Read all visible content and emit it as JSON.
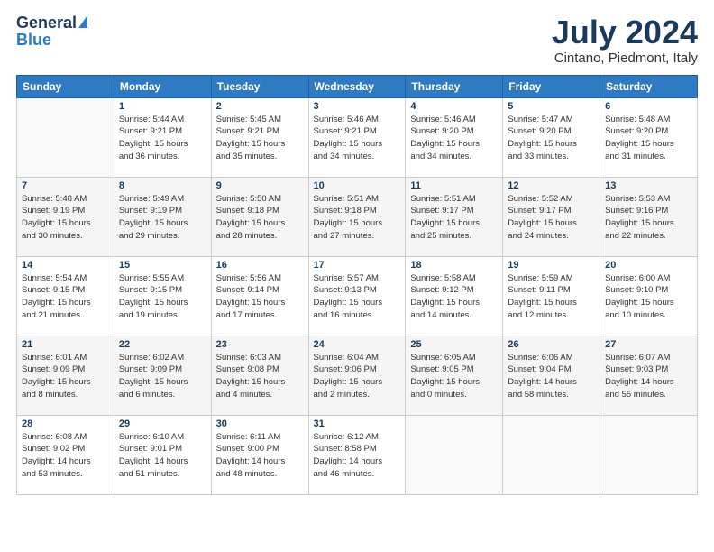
{
  "logo": {
    "general": "General",
    "blue": "Blue"
  },
  "title": "July 2024",
  "subtitle": "Cintano, Piedmont, Italy",
  "days_of_week": [
    "Sunday",
    "Monday",
    "Tuesday",
    "Wednesday",
    "Thursday",
    "Friday",
    "Saturday"
  ],
  "weeks": [
    [
      {
        "day": "",
        "info": ""
      },
      {
        "day": "1",
        "info": "Sunrise: 5:44 AM\nSunset: 9:21 PM\nDaylight: 15 hours\nand 36 minutes."
      },
      {
        "day": "2",
        "info": "Sunrise: 5:45 AM\nSunset: 9:21 PM\nDaylight: 15 hours\nand 35 minutes."
      },
      {
        "day": "3",
        "info": "Sunrise: 5:46 AM\nSunset: 9:21 PM\nDaylight: 15 hours\nand 34 minutes."
      },
      {
        "day": "4",
        "info": "Sunrise: 5:46 AM\nSunset: 9:20 PM\nDaylight: 15 hours\nand 34 minutes."
      },
      {
        "day": "5",
        "info": "Sunrise: 5:47 AM\nSunset: 9:20 PM\nDaylight: 15 hours\nand 33 minutes."
      },
      {
        "day": "6",
        "info": "Sunrise: 5:48 AM\nSunset: 9:20 PM\nDaylight: 15 hours\nand 31 minutes."
      }
    ],
    [
      {
        "day": "7",
        "info": "Sunrise: 5:48 AM\nSunset: 9:19 PM\nDaylight: 15 hours\nand 30 minutes."
      },
      {
        "day": "8",
        "info": "Sunrise: 5:49 AM\nSunset: 9:19 PM\nDaylight: 15 hours\nand 29 minutes."
      },
      {
        "day": "9",
        "info": "Sunrise: 5:50 AM\nSunset: 9:18 PM\nDaylight: 15 hours\nand 28 minutes."
      },
      {
        "day": "10",
        "info": "Sunrise: 5:51 AM\nSunset: 9:18 PM\nDaylight: 15 hours\nand 27 minutes."
      },
      {
        "day": "11",
        "info": "Sunrise: 5:51 AM\nSunset: 9:17 PM\nDaylight: 15 hours\nand 25 minutes."
      },
      {
        "day": "12",
        "info": "Sunrise: 5:52 AM\nSunset: 9:17 PM\nDaylight: 15 hours\nand 24 minutes."
      },
      {
        "day": "13",
        "info": "Sunrise: 5:53 AM\nSunset: 9:16 PM\nDaylight: 15 hours\nand 22 minutes."
      }
    ],
    [
      {
        "day": "14",
        "info": "Sunrise: 5:54 AM\nSunset: 9:15 PM\nDaylight: 15 hours\nand 21 minutes."
      },
      {
        "day": "15",
        "info": "Sunrise: 5:55 AM\nSunset: 9:15 PM\nDaylight: 15 hours\nand 19 minutes."
      },
      {
        "day": "16",
        "info": "Sunrise: 5:56 AM\nSunset: 9:14 PM\nDaylight: 15 hours\nand 17 minutes."
      },
      {
        "day": "17",
        "info": "Sunrise: 5:57 AM\nSunset: 9:13 PM\nDaylight: 15 hours\nand 16 minutes."
      },
      {
        "day": "18",
        "info": "Sunrise: 5:58 AM\nSunset: 9:12 PM\nDaylight: 15 hours\nand 14 minutes."
      },
      {
        "day": "19",
        "info": "Sunrise: 5:59 AM\nSunset: 9:11 PM\nDaylight: 15 hours\nand 12 minutes."
      },
      {
        "day": "20",
        "info": "Sunrise: 6:00 AM\nSunset: 9:10 PM\nDaylight: 15 hours\nand 10 minutes."
      }
    ],
    [
      {
        "day": "21",
        "info": "Sunrise: 6:01 AM\nSunset: 9:09 PM\nDaylight: 15 hours\nand 8 minutes."
      },
      {
        "day": "22",
        "info": "Sunrise: 6:02 AM\nSunset: 9:09 PM\nDaylight: 15 hours\nand 6 minutes."
      },
      {
        "day": "23",
        "info": "Sunrise: 6:03 AM\nSunset: 9:08 PM\nDaylight: 15 hours\nand 4 minutes."
      },
      {
        "day": "24",
        "info": "Sunrise: 6:04 AM\nSunset: 9:06 PM\nDaylight: 15 hours\nand 2 minutes."
      },
      {
        "day": "25",
        "info": "Sunrise: 6:05 AM\nSunset: 9:05 PM\nDaylight: 15 hours\nand 0 minutes."
      },
      {
        "day": "26",
        "info": "Sunrise: 6:06 AM\nSunset: 9:04 PM\nDaylight: 14 hours\nand 58 minutes."
      },
      {
        "day": "27",
        "info": "Sunrise: 6:07 AM\nSunset: 9:03 PM\nDaylight: 14 hours\nand 55 minutes."
      }
    ],
    [
      {
        "day": "28",
        "info": "Sunrise: 6:08 AM\nSunset: 9:02 PM\nDaylight: 14 hours\nand 53 minutes."
      },
      {
        "day": "29",
        "info": "Sunrise: 6:10 AM\nSunset: 9:01 PM\nDaylight: 14 hours\nand 51 minutes."
      },
      {
        "day": "30",
        "info": "Sunrise: 6:11 AM\nSunset: 9:00 PM\nDaylight: 14 hours\nand 48 minutes."
      },
      {
        "day": "31",
        "info": "Sunrise: 6:12 AM\nSunset: 8:58 PM\nDaylight: 14 hours\nand 46 minutes."
      },
      {
        "day": "",
        "info": ""
      },
      {
        "day": "",
        "info": ""
      },
      {
        "day": "",
        "info": ""
      }
    ]
  ]
}
